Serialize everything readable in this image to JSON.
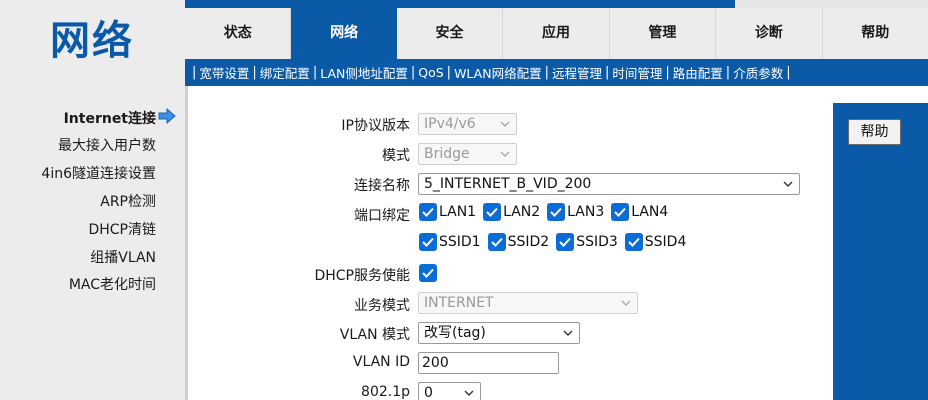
{
  "logo": {
    "text": "网络"
  },
  "nav": {
    "tabs": [
      {
        "label": "状态",
        "active": false
      },
      {
        "label": "网络",
        "active": true
      },
      {
        "label": "安全",
        "active": false
      },
      {
        "label": "应用",
        "active": false
      },
      {
        "label": "管理",
        "active": false
      },
      {
        "label": "诊断",
        "active": false
      },
      {
        "label": "帮助",
        "active": false
      }
    ]
  },
  "subnav": {
    "items": [
      "宽带设置",
      "绑定配置",
      "LAN侧地址配置",
      "QoS",
      "WLAN网络配置",
      "远程管理",
      "时间管理",
      "路由配置",
      "介质参数"
    ],
    "active_index": 0
  },
  "sidebar": {
    "items": [
      {
        "label": "Internet连接",
        "active": true
      },
      {
        "label": "最大接入用户数",
        "active": false
      },
      {
        "label": "4in6隧道连接设置",
        "active": false
      },
      {
        "label": "ARP检测",
        "active": false
      },
      {
        "label": "DHCP清链",
        "active": false
      },
      {
        "label": "组播VLAN",
        "active": false
      },
      {
        "label": "MAC老化时间",
        "active": false
      }
    ]
  },
  "form": {
    "ip_version": {
      "label": "IP协议版本",
      "value": "IPv4/v6",
      "disabled": true
    },
    "mode": {
      "label": "模式",
      "value": "Bridge",
      "disabled": true
    },
    "connection_name": {
      "label": "连接名称",
      "value": "5_INTERNET_B_VID_200"
    },
    "port_binding": {
      "label": "端口绑定",
      "ports_row1": [
        {
          "label": "LAN1",
          "checked": true
        },
        {
          "label": "LAN2",
          "checked": true
        },
        {
          "label": "LAN3",
          "checked": true
        },
        {
          "label": "LAN4",
          "checked": true
        }
      ],
      "ports_row2": [
        {
          "label": "SSID1",
          "checked": true
        },
        {
          "label": "SSID2",
          "checked": true
        },
        {
          "label": "SSID3",
          "checked": true
        },
        {
          "label": "SSID4",
          "checked": true
        }
      ]
    },
    "dhcp_enable": {
      "label": "DHCP服务使能",
      "checked": true
    },
    "service_mode": {
      "label": "业务模式",
      "value": "INTERNET",
      "disabled": true
    },
    "vlan_mode": {
      "label": "VLAN 模式",
      "value": "改写(tag)"
    },
    "vlan_id": {
      "label": "VLAN ID",
      "value": "200"
    },
    "dot1p": {
      "label": "802.1p",
      "value": "0"
    }
  },
  "help": {
    "button_label": "帮助"
  },
  "colors": {
    "brand_blue": "#0b5aa8",
    "checkbox_blue": "#0b6cd6",
    "panel_gray": "#ececec"
  }
}
